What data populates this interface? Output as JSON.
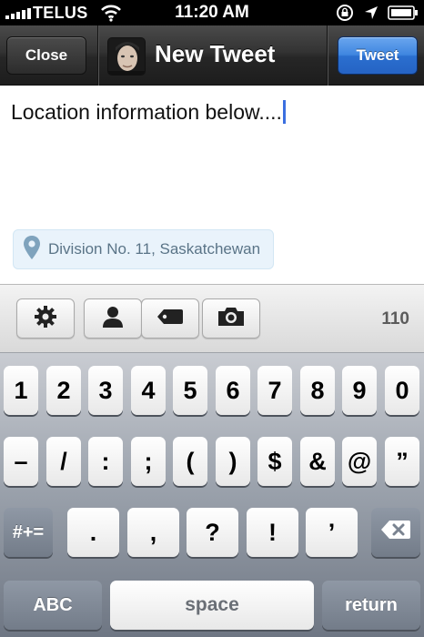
{
  "status_bar": {
    "carrier": "TELUS",
    "time": "11:20 AM"
  },
  "nav_bar": {
    "close_label": "Close",
    "title": "New Tweet",
    "tweet_label": "Tweet"
  },
  "compose": {
    "text": "Location information below....",
    "location": "Division No. 11, Saskatchewan"
  },
  "toolbar": {
    "icons": [
      "gear-icon",
      "person-icon",
      "tag-icon",
      "camera-icon"
    ],
    "char_count": "110"
  },
  "keyboard": {
    "row1": [
      "1",
      "2",
      "3",
      "4",
      "5",
      "6",
      "7",
      "8",
      "9",
      "0"
    ],
    "row2": [
      "–",
      "/",
      ":",
      ";",
      "(",
      ")",
      "$",
      "&",
      "@",
      "”"
    ],
    "row3_shift": "#+=",
    "row3": [
      ".",
      ",",
      "?",
      "!",
      "’"
    ],
    "backspace_icon": "backspace-icon",
    "abc_label": "ABC",
    "space_label": "space",
    "return_label": "return"
  },
  "colors": {
    "tweet_button": "#2b6fcf",
    "caret": "#3b6fe0",
    "location_text": "#5a7487"
  }
}
